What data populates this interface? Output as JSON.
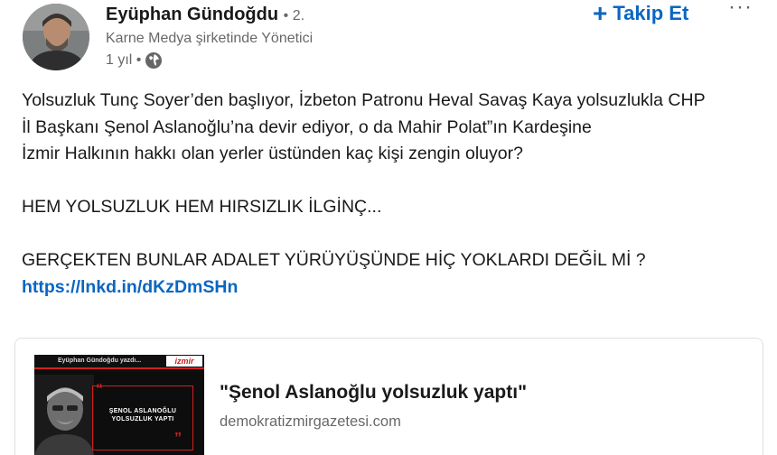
{
  "author": {
    "name": "Eyüphan Gündoğdu",
    "degree": "• 2.",
    "headline": "Karne Medya şirketinde Yönetici",
    "time": "1 yıl •",
    "visibility_icon": "globe-icon"
  },
  "actions": {
    "follow_icon": "plus-icon",
    "follow_plus": "+",
    "follow_label": "Takip Et",
    "more_label": "···"
  },
  "post": {
    "lines": [
      "Yolsuzluk Tunç Soyer’den başlıyor, İzbeton Patronu Heval Savaş Kaya yolsuzlukla CHP",
      "İl Başkanı Şenol Aslanoğlu’na devir ediyor, o da Mahir Polat”ın Kardeşine",
      "İzmir Halkının hakkı olan yerler üstünden kaç kişi zengin oluyor?",
      "HEM YOLSUZLUK HEM HIRSIZLIK İLGİNÇ...",
      "GERÇEKTEN BUNLAR ADALET YÜRÜYÜŞÜNDE HİÇ YOKLARDI DEĞİL Mİ ?"
    ],
    "link": "https://lnkd.in/dKzDmSHn"
  },
  "link_card": {
    "title": "\"Şenol Aslanoğlu yolsuzluk yaptı\"",
    "domain": "demokratizmirgazetesi.com",
    "thumbnail": {
      "byline": "Eyüphan Gündoğdu yazdı...",
      "logo": "izmir",
      "headline": "ŞENOL ASLANOĞLU YOLSUZLUK YAPTI",
      "quote_open": "“",
      "quote_close": "”"
    }
  },
  "colors": {
    "link_blue": "#0a66c2",
    "text_primary": "#000000e6",
    "text_secondary": "#00000099",
    "thumb_red": "#d21f1f"
  }
}
